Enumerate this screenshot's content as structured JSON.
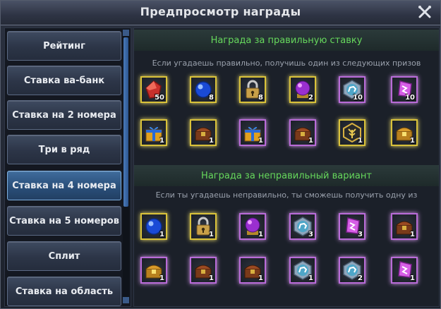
{
  "window": {
    "title": "Предпросмотр награды"
  },
  "sidebar": {
    "items": [
      {
        "label": "Рейтинг"
      },
      {
        "label": "Ставка ва-банк"
      },
      {
        "label": "Ставка на 2 номера"
      },
      {
        "label": "Три в ряд"
      },
      {
        "label": "Ставка на 4 номера"
      },
      {
        "label": "Ставка на 5 номеров"
      },
      {
        "label": "Сплит"
      },
      {
        "label": "Ставка на область"
      }
    ],
    "active_index": 4
  },
  "correct": {
    "title": "Награда за правильную ставку",
    "subtitle": "Если угадаешь правильно, получишь один из следующих призов",
    "rows": [
      [
        {
          "icon": "red-gem-icon",
          "qty": "50",
          "frame": "gold"
        },
        {
          "icon": "blue-orb-icon",
          "qty": "8",
          "frame": "gold"
        },
        {
          "icon": "padlock-icon",
          "qty": "8",
          "frame": "gold"
        },
        {
          "icon": "purple-orb-icon",
          "qty": "2",
          "frame": "gold"
        },
        {
          "icon": "horse-coin-icon",
          "qty": "10",
          "frame": "purple"
        },
        {
          "icon": "purple-crystal-icon",
          "qty": "10",
          "frame": "purple"
        }
      ],
      [
        {
          "icon": "gift-box-icon",
          "qty": "1",
          "frame": "gold"
        },
        {
          "icon": "treasure-chest-icon",
          "qty": "1",
          "frame": "gold"
        },
        {
          "icon": "gift-box-icon",
          "qty": "1",
          "frame": "purple"
        },
        {
          "icon": "treasure-chest-icon",
          "qty": "1",
          "frame": "purple"
        },
        {
          "icon": "golden-tree-icon",
          "qty": "1",
          "frame": "gold"
        },
        {
          "icon": "golden-chest-icon",
          "qty": "1",
          "frame": "gold"
        }
      ]
    ]
  },
  "wrong": {
    "title": "Награда за неправильный вариант",
    "subtitle": "Если ты угадаешь неправильно, ты сможешь получить одну из",
    "rows": [
      [
        {
          "icon": "blue-orb-icon",
          "qty": "1",
          "frame": "gold"
        },
        {
          "icon": "padlock-icon",
          "qty": "1",
          "frame": "gold"
        },
        {
          "icon": "purple-orb-icon",
          "qty": "1",
          "frame": "purple"
        },
        {
          "icon": "horse-coin-icon",
          "qty": "3",
          "frame": "purple"
        },
        {
          "icon": "purple-crystal-icon",
          "qty": "3",
          "frame": "purple"
        },
        {
          "icon": "treasure-chest-icon",
          "qty": "1",
          "frame": "purple"
        }
      ],
      [
        {
          "icon": "golden-chest-icon",
          "qty": "1",
          "frame": "purple"
        },
        {
          "icon": "treasure-chest-icon",
          "qty": "1",
          "frame": "purple"
        },
        {
          "icon": "treasure-chest-icon",
          "qty": "1",
          "frame": "purple"
        },
        {
          "icon": "horse-coin-icon",
          "qty": "1",
          "frame": "purple"
        },
        {
          "icon": "horse-coin-icon",
          "qty": "2",
          "frame": "purple"
        },
        {
          "icon": "purple-crystal-icon",
          "qty": "1",
          "frame": "purple"
        }
      ]
    ]
  }
}
